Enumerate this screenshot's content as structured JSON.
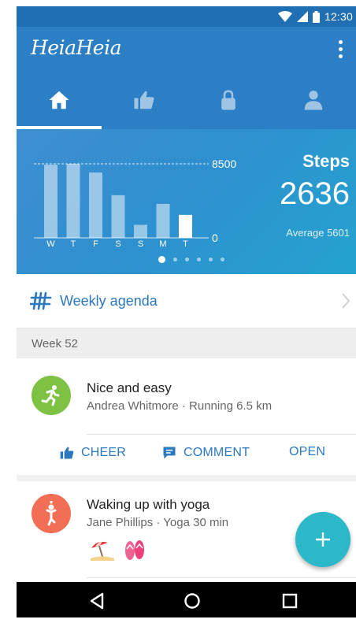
{
  "status_bar": {
    "time": "12:30",
    "icons": [
      "wifi-icon",
      "cell-signal-icon",
      "battery-icon"
    ]
  },
  "app": {
    "title": "HeiaHeia",
    "menu_icon": "more-vert-icon"
  },
  "tabs": [
    {
      "icon": "home-icon",
      "selected": true
    },
    {
      "icon": "thumbs-up-icon",
      "selected": false
    },
    {
      "icon": "lock-icon",
      "selected": false
    },
    {
      "icon": "person-icon",
      "selected": false
    }
  ],
  "steps_card": {
    "label": "Steps",
    "value": "2636",
    "average": "Average 5601",
    "page_index": 0,
    "page_count": 6
  },
  "chart_data": {
    "type": "bar",
    "categories": [
      "W",
      "T",
      "F",
      "S",
      "S",
      "M",
      "T"
    ],
    "values": [
      8400,
      8500,
      7500,
      4900,
      1500,
      3900,
      2636
    ],
    "highlight_index": 6,
    "ylim": [
      0,
      8500
    ],
    "ticks": [
      "8500",
      "0"
    ],
    "reference_line": 8500,
    "title": "",
    "xlabel": "",
    "ylabel": ""
  },
  "agenda": {
    "label": "Weekly agenda",
    "icon": "tally-hash-icon"
  },
  "week_header": "Week 52",
  "feed": [
    {
      "title": "Nice and easy",
      "subtitle": "Andrea Whitmore · Running 6.5 km",
      "avatar_icon": "running-icon",
      "avatar_color": "#7dc242",
      "actions": {
        "cheer": "CHEER",
        "comment": "COMMENT",
        "open": "OPEN"
      }
    },
    {
      "title": "Waking up with yoga",
      "subtitle": "Jane Phillips · Yoga 30 min",
      "avatar_icon": "yoga-icon",
      "avatar_color": "#f26e55",
      "reactions": [
        "beach-umbrella-icon",
        "flip-flops-icon"
      ]
    }
  ],
  "fab": {
    "icon": "plus-icon"
  },
  "navbar": {
    "icons": [
      "back-icon",
      "home-circle-icon",
      "recents-icon"
    ]
  },
  "colors": {
    "primary": "#2c7fc4",
    "accent": "#2bb8c9",
    "link": "#2b78bd"
  }
}
